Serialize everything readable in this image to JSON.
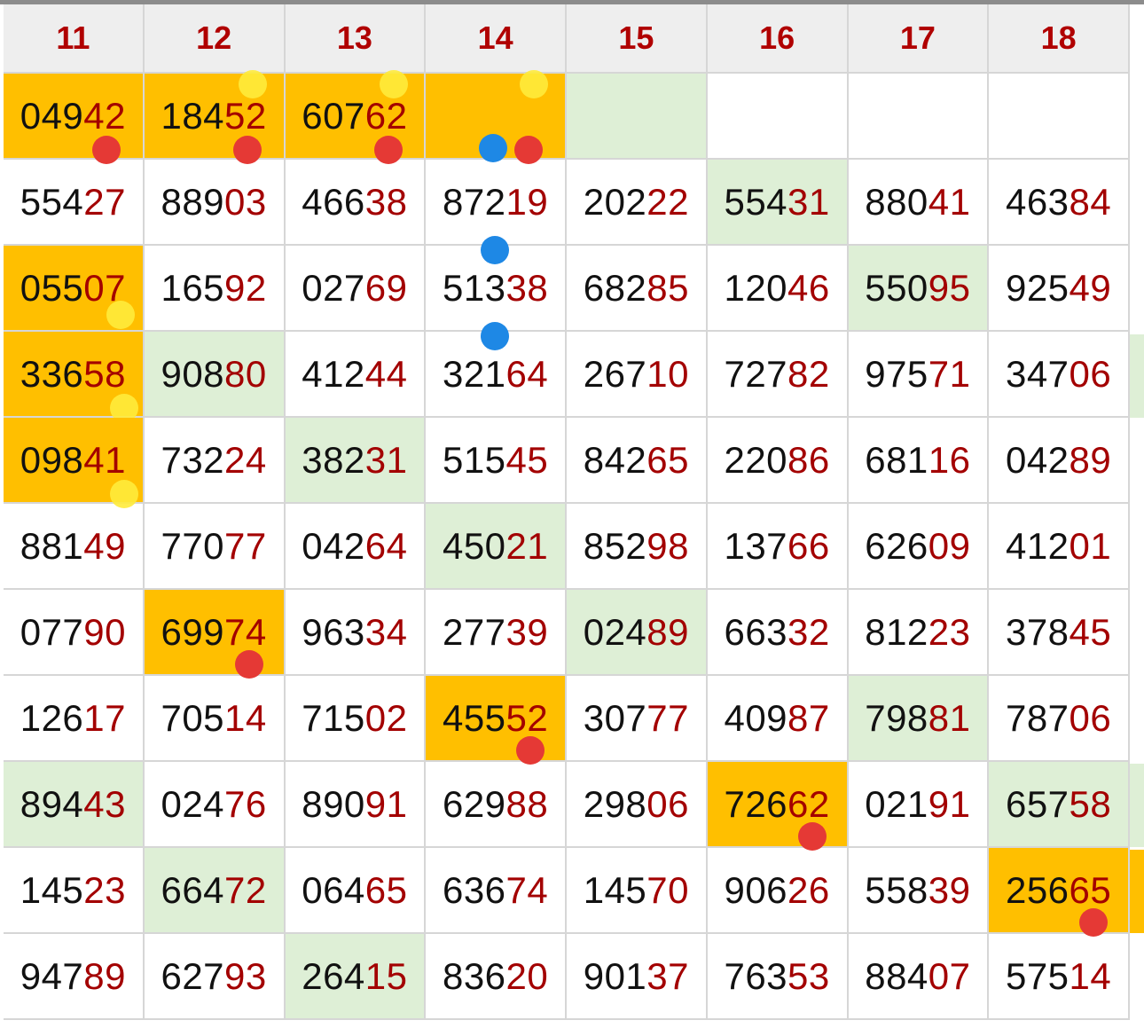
{
  "columns": [
    "11",
    "12",
    "13",
    "14",
    "15",
    "16",
    "17",
    "18"
  ],
  "colors": {
    "header_text": "#b00000",
    "highlight_orange": "#ffbf00",
    "highlight_green": "#deefd6",
    "tail_digits": "#a30000",
    "dot_red": "#e53935",
    "dot_yellow": "#ffeb3b",
    "dot_blue": "#1e88e5"
  },
  "rows": [
    [
      {
        "head": "049",
        "tail": "42",
        "hl": "orange",
        "dots": [
          "red"
        ]
      },
      {
        "head": "184",
        "tail": "52",
        "hl": "orange",
        "dots": [
          "red",
          "yellow"
        ]
      },
      {
        "head": "607",
        "tail": "62",
        "hl": "orange",
        "dots": [
          "red",
          "yellow"
        ]
      },
      {
        "head": "",
        "tail": "",
        "hl": "orange",
        "dots": [
          "red",
          "blue",
          "yellow"
        ]
      },
      {
        "head": "",
        "tail": "",
        "hl": "green"
      },
      {
        "head": "",
        "tail": ""
      },
      {
        "head": "",
        "tail": ""
      },
      {
        "head": "",
        "tail": ""
      }
    ],
    [
      {
        "head": "554",
        "tail": "27"
      },
      {
        "head": "889",
        "tail": "03"
      },
      {
        "head": "466",
        "tail": "38"
      },
      {
        "head": "872",
        "tail": "19",
        "dots": [
          "blue"
        ]
      },
      {
        "head": "202",
        "tail": "22"
      },
      {
        "head": "554",
        "tail": "31",
        "hl": "green"
      },
      {
        "head": "880",
        "tail": "41"
      },
      {
        "head": "463",
        "tail": "84"
      }
    ],
    [
      {
        "head": "055",
        "tail": "07",
        "hl": "orange",
        "dots": [
          "yellow"
        ]
      },
      {
        "head": "165",
        "tail": "92"
      },
      {
        "head": "027",
        "tail": "69"
      },
      {
        "head": "513",
        "tail": "38",
        "dots": [
          "blue"
        ]
      },
      {
        "head": "682",
        "tail": "85"
      },
      {
        "head": "120",
        "tail": "46"
      },
      {
        "head": "550",
        "tail": "95",
        "hl": "green"
      },
      {
        "head": "925",
        "tail": "49"
      }
    ],
    [
      {
        "head": "336",
        "tail": "58",
        "hl": "orange",
        "dots": [
          "yellow"
        ]
      },
      {
        "head": "908",
        "tail": "80",
        "hl": "green"
      },
      {
        "head": "412",
        "tail": "44"
      },
      {
        "head": "321",
        "tail": "64"
      },
      {
        "head": "267",
        "tail": "10"
      },
      {
        "head": "727",
        "tail": "82"
      },
      {
        "head": "975",
        "tail": "71"
      },
      {
        "head": "347",
        "tail": "06"
      }
    ],
    [
      {
        "head": "098",
        "tail": "41",
        "hl": "orange",
        "dots": [
          "yellow"
        ]
      },
      {
        "head": "732",
        "tail": "24"
      },
      {
        "head": "382",
        "tail": "31",
        "hl": "green"
      },
      {
        "head": "515",
        "tail": "45"
      },
      {
        "head": "842",
        "tail": "65"
      },
      {
        "head": "220",
        "tail": "86"
      },
      {
        "head": "681",
        "tail": "16"
      },
      {
        "head": "042",
        "tail": "89"
      }
    ],
    [
      {
        "head": "881",
        "tail": "49"
      },
      {
        "head": "770",
        "tail": "77"
      },
      {
        "head": "042",
        "tail": "64"
      },
      {
        "head": "450",
        "tail": "21",
        "hl": "green"
      },
      {
        "head": "852",
        "tail": "98"
      },
      {
        "head": "137",
        "tail": "66"
      },
      {
        "head": "626",
        "tail": "09"
      },
      {
        "head": "412",
        "tail": "01"
      }
    ],
    [
      {
        "head": "077",
        "tail": "90"
      },
      {
        "head": "699",
        "tail": "74",
        "hl": "orange",
        "dots": [
          "red"
        ]
      },
      {
        "head": "963",
        "tail": "34"
      },
      {
        "head": "277",
        "tail": "39"
      },
      {
        "head": "024",
        "tail": "89",
        "hl": "green"
      },
      {
        "head": "663",
        "tail": "32"
      },
      {
        "head": "812",
        "tail": "23"
      },
      {
        "head": "378",
        "tail": "45"
      }
    ],
    [
      {
        "head": "126",
        "tail": "17"
      },
      {
        "head": "705",
        "tail": "14"
      },
      {
        "head": "715",
        "tail": "02"
      },
      {
        "head": "455",
        "tail": "52",
        "hl": "orange",
        "dots": [
          "red"
        ]
      },
      {
        "head": "307",
        "tail": "77"
      },
      {
        "head": "409",
        "tail": "87"
      },
      {
        "head": "798",
        "tail": "81",
        "hl": "green"
      },
      {
        "head": "787",
        "tail": "06"
      }
    ],
    [
      {
        "head": "894",
        "tail": "43",
        "hl": "green"
      },
      {
        "head": "024",
        "tail": "76"
      },
      {
        "head": "890",
        "tail": "91"
      },
      {
        "head": "629",
        "tail": "88"
      },
      {
        "head": "298",
        "tail": "06"
      },
      {
        "head": "726",
        "tail": "62",
        "hl": "orange",
        "dots": [
          "red"
        ]
      },
      {
        "head": "021",
        "tail": "91"
      },
      {
        "head": "657",
        "tail": "58",
        "hl": "green"
      }
    ],
    [
      {
        "head": "145",
        "tail": "23"
      },
      {
        "head": "664",
        "tail": "72",
        "hl": "green"
      },
      {
        "head": "064",
        "tail": "65"
      },
      {
        "head": "636",
        "tail": "74"
      },
      {
        "head": "145",
        "tail": "70"
      },
      {
        "head": "906",
        "tail": "26"
      },
      {
        "head": "558",
        "tail": "39"
      },
      {
        "head": "256",
        "tail": "65",
        "hl": "orange",
        "dots": [
          "red"
        ]
      }
    ],
    [
      {
        "head": "947",
        "tail": "89"
      },
      {
        "head": "627",
        "tail": "93"
      },
      {
        "head": "264",
        "tail": "15",
        "hl": "green"
      },
      {
        "head": "836",
        "tail": "20"
      },
      {
        "head": "901",
        "tail": "37"
      },
      {
        "head": "763",
        "tail": "53"
      },
      {
        "head": "884",
        "tail": "07"
      },
      {
        "head": "575",
        "tail": "14"
      }
    ]
  ]
}
